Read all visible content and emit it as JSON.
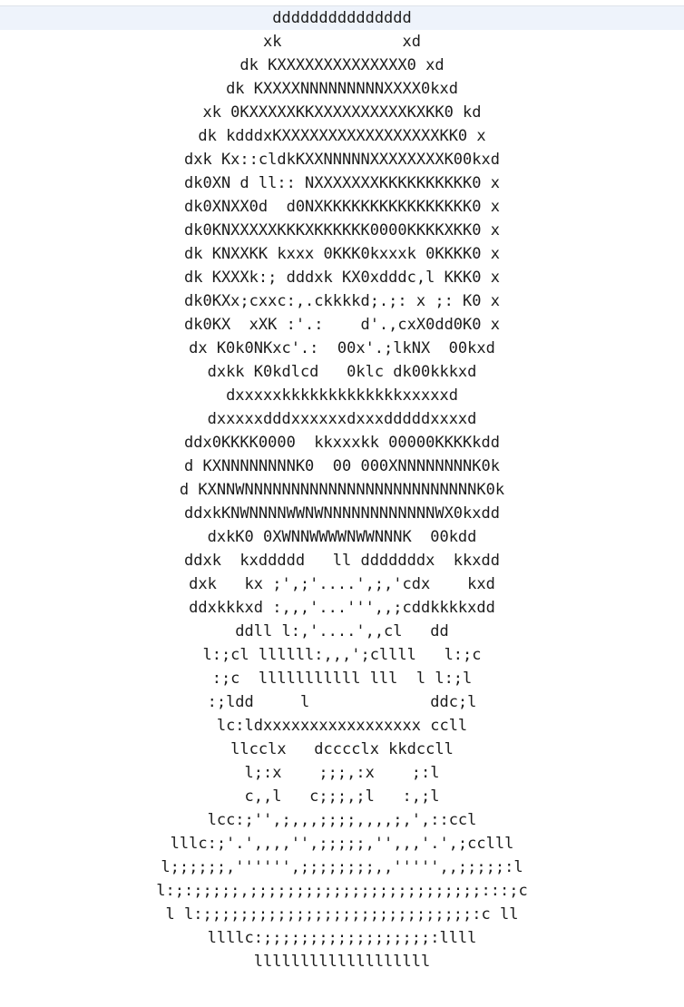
{
  "ascii_art": {
    "lines": [
      "ddddddddddddddd",
      "xk             xd",
      "dk KXXXXXXXXXXXXXX0 xd",
      "dk KXXXXNNNNNNNNNXXXX0kxd",
      "xk 0KXXXXXKKXXXXXXXXXXKXKK0 kd",
      "dk kdddxKXXXXXXXXXXXXXXXXXKK0 x",
      "dxk Kx::cldkKXXNNNNNXXXXXXXXK00kxd",
      "dk0XN d ll:: NXXXXXXXKKKKKKKKKK0 x",
      "dk0XNXX0d  d0NXKKKKKKKKKKKKKKKK0 x",
      "dk0KNXXXXXKKKXKKKKKK0000KKKKXKK0 x",
      "dk KNXXKK kxxx 0KKK0kxxxk 0KKKK0 x",
      "dk KXXXk:; dddxk KX0xdddc,l KKK0 x",
      "dk0KXx;cxxc:,.ckkkkd;.;: x ;: K0 x",
      "dk0KX  xXK :'.:    d'.,cxX0dd0K0 x",
      "dx K0k0NKxc'.:  00x'.;lkNX  00kxd",
      "dxkk K0kdlcd   0klc dk00kkkxd",
      "dxxxxxkkkkkkkkkkkkkxxxxxd",
      "dxxxxxdddxxxxxxdxxxdddddxxxxd",
      "ddx0KKKK0000  kkxxxkk 00000KKKKkdd",
      "d KXNNNNNNNNK0  00 000XNNNNNNNNK0k",
      "d KXNNWNNNNNNNNNNNNNNNNNNNNNNNNNK0k",
      "ddxkKNWNNNNWWNWNNNNNNNNNNNNWX0kxdd",
      "dxkK0 0XWNNWWWWNWWNNNK  00kdd",
      "ddxk  kxddddd   ll dddddddx  kkxdd",
      "dxk   kx ;',;'....',;,'cdx    kxd",
      "ddxkkkxd :,,,'...''',,;cddkkkkxdd",
      "ddll l:,'....',,cl   dd",
      "l:;cl llllll:,,,';cllll   l:;c",
      ":;c  lllllllllll lll  l l:;l",
      ":;ldd     l             ddc;l",
      "lc:ldxxxxxxxxxxxxxxxxx ccll",
      "llcclx   dcccclx kkdccll",
      "l;:x    ;;;,:x    ;:l",
      "c,,l   c;;;,;l   :,;l",
      "lcc:;'',;,,,;;;;,,,,;,',::ccl",
      "lllc:;'.',,,,'',;;;;;,'',,,'.',;cclll",
      "l;;;;;;,'''''',;;;;;;;;,,''''',,;;;;;:l",
      "l:;:;;;;;,;;;;;;;;;;;;;;;;;;;;;;;;;:::;c",
      "l l:;;;;;;;;;;;;;;;;;;;;;;;;;;;;;:c ll",
      "llllc:;;;;;;;;;;;;;;;;;;:llll",
      "lllllllllllllllllll"
    ]
  }
}
